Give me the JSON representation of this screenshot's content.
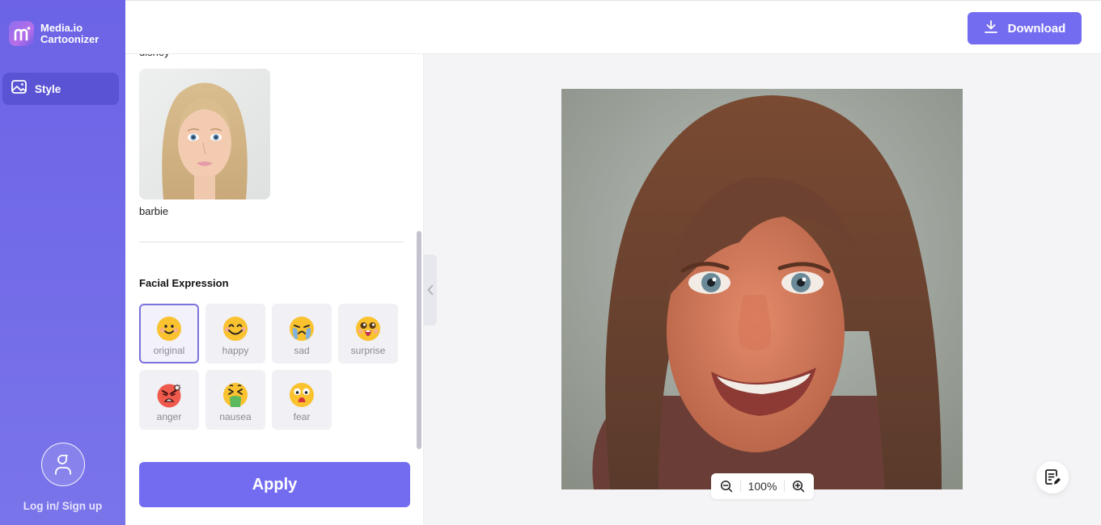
{
  "app": {
    "brand_line1": "Media.io",
    "brand_line2": "Cartoonizer"
  },
  "sidebar": {
    "items": [
      {
        "label": "Style",
        "icon": "image-icon",
        "active": true
      }
    ],
    "login_label": "Log in/ Sign up"
  },
  "header": {
    "download_label": "Download"
  },
  "panel": {
    "previous_style_label": "disney",
    "style_card": {
      "label": "barbie"
    },
    "expression_title": "Facial Expression",
    "expressions": [
      {
        "label": "original",
        "icon": "smile-emoji-icon",
        "selected": true
      },
      {
        "label": "happy",
        "icon": "happy-emoji-icon",
        "selected": false
      },
      {
        "label": "sad",
        "icon": "crying-emoji-icon",
        "selected": false
      },
      {
        "label": "surprise",
        "icon": "surprise-emoji-icon",
        "selected": false
      },
      {
        "label": "anger",
        "icon": "angry-emoji-icon",
        "selected": false
      },
      {
        "label": "nausea",
        "icon": "nausea-emoji-icon",
        "selected": false
      },
      {
        "label": "fear",
        "icon": "fear-emoji-icon",
        "selected": false
      }
    ],
    "apply_label": "Apply"
  },
  "canvas": {
    "zoom_level": "100%"
  },
  "colors": {
    "accent": "#736cf0",
    "sidebar": "#6c63e6",
    "selected_border": "#7b72dc"
  }
}
